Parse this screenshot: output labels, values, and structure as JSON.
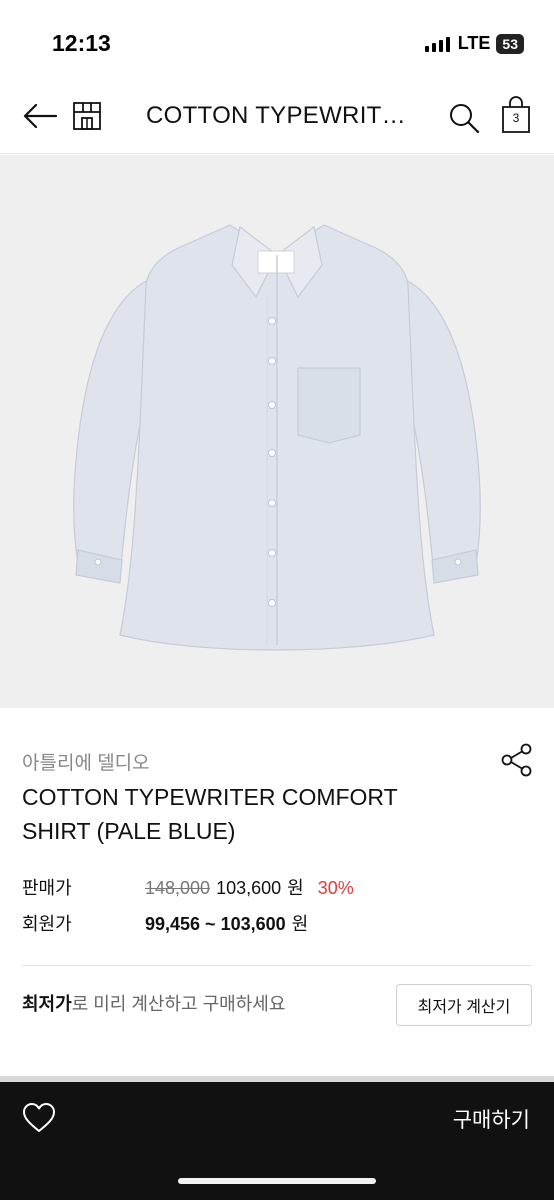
{
  "status_bar": {
    "time": "12:13",
    "network": "LTE",
    "battery": "53"
  },
  "header": {
    "title": "COTTON TYPEWRITER COMFORT SHIRT (PALE BLUE)",
    "bag_count": "3"
  },
  "product": {
    "image_alt": "pale blue oxford shirt",
    "brand": "아틀리에 델디오",
    "name": "COTTON TYPEWRITER COMFORT SHIRT (PALE BLUE)"
  },
  "pricing": {
    "sale_label": "판매가",
    "original_price": "148,000",
    "sale_price": "103,600",
    "currency": "원",
    "discount": "30%",
    "member_label": "회원가",
    "member_price_range": "99,456 ~ 103,600",
    "member_currency": "원"
  },
  "lowest_price": {
    "highlight": "최저가",
    "text": "로 미리 계산하고 구매하세요",
    "button_label": "최저가 계산기"
  },
  "bottom_bar": {
    "buy_label": "구매하기"
  },
  "colors": {
    "discount": "#e03c3c",
    "bottom_bar": "#111111",
    "image_bg": "#efefef"
  }
}
